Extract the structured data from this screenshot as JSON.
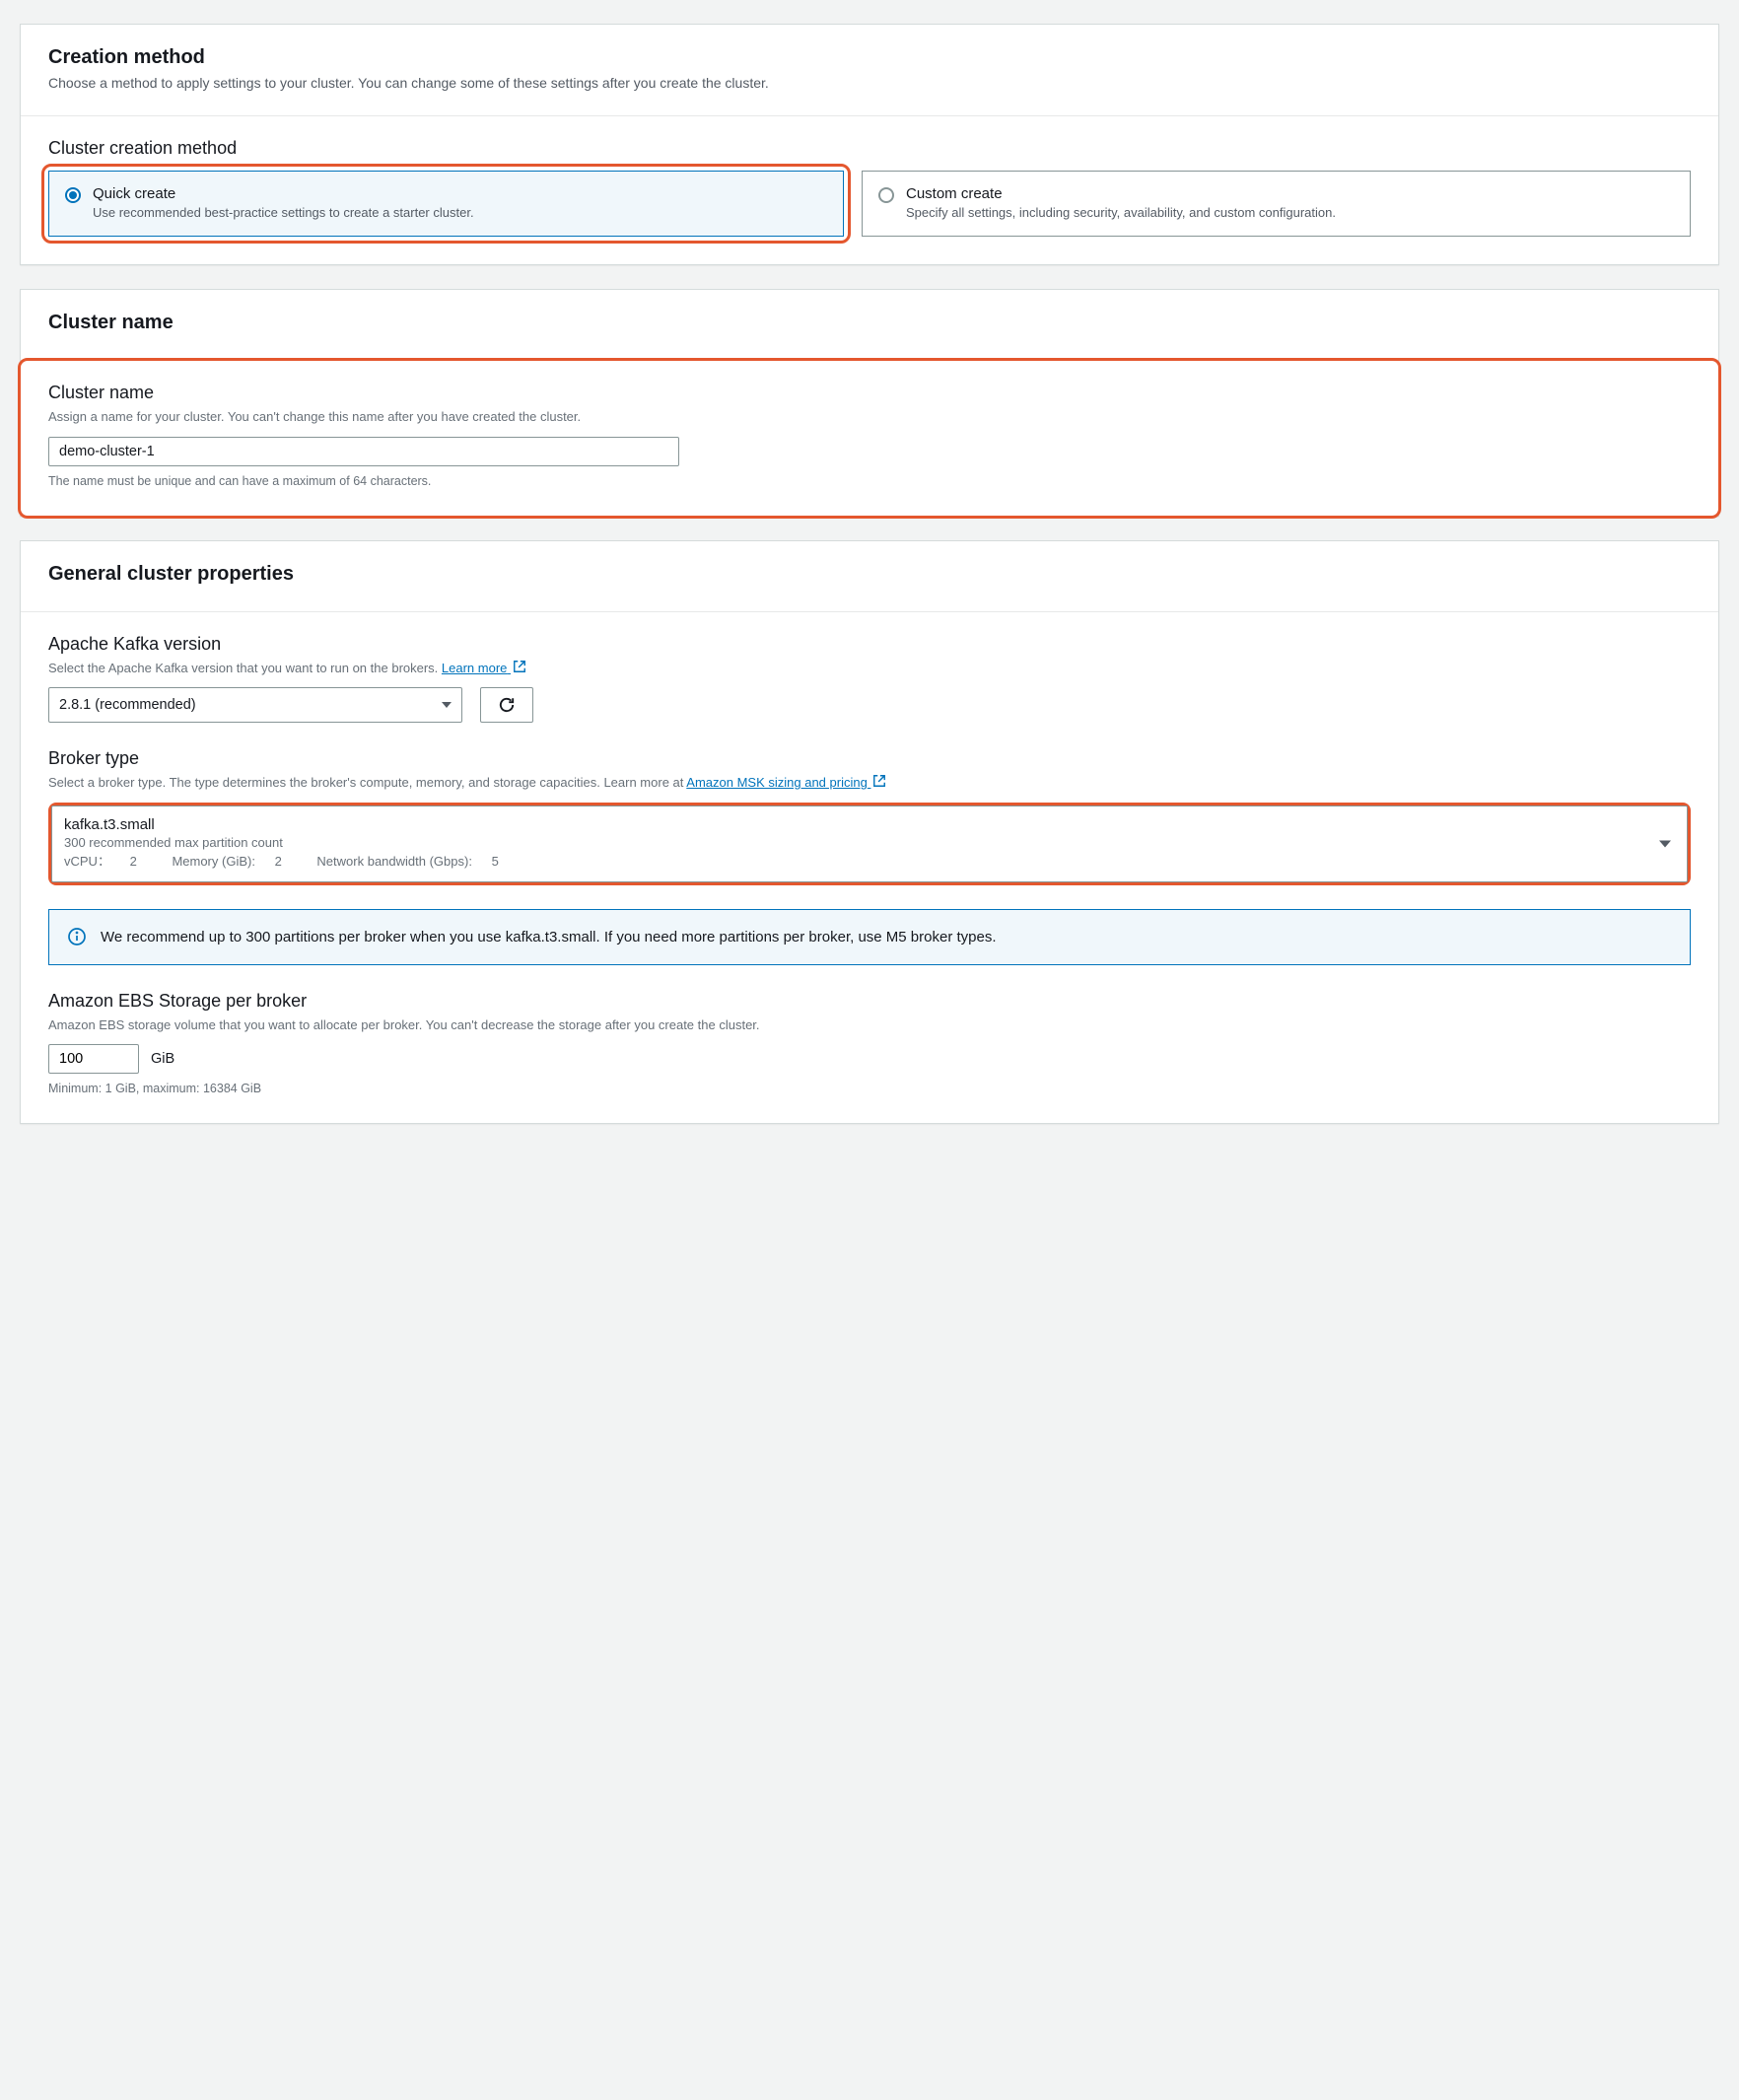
{
  "creation_method": {
    "title": "Creation method",
    "subtitle": "Choose a method to apply settings to your cluster. You can change some of these settings after you create the cluster.",
    "section_label": "Cluster creation method",
    "options": {
      "quick": {
        "title": "Quick create",
        "desc": "Use recommended best-practice settings to create a starter cluster."
      },
      "custom": {
        "title": "Custom create",
        "desc": "Specify all settings, including security, availability, and custom configuration."
      }
    }
  },
  "cluster_name": {
    "panel_title": "Cluster name",
    "field_label": "Cluster name",
    "field_desc": "Assign a name for your cluster. You can't change this name after you have created the cluster.",
    "value": "demo-cluster-1",
    "hint": "The name must be unique and can have a maximum of 64 characters."
  },
  "general": {
    "panel_title": "General cluster properties",
    "kafka_version": {
      "label": "Apache Kafka version",
      "desc_prefix": "Select the Apache Kafka version that you want to run on the brokers. ",
      "learn_more": "Learn more",
      "selected": "2.8.1 (recommended)"
    },
    "broker_type": {
      "label": "Broker type",
      "desc_prefix": "Select a broker type. The type determines the broker's compute, memory, and storage capacities. Learn more at ",
      "link_text": "Amazon MSK sizing and pricing",
      "selected": "kafka.t3.small",
      "partition_line": "300 recommended max partition count",
      "spec_vcpu_label": "vCPU：",
      "spec_vcpu": "2",
      "spec_mem_label": "Memory (GiB):",
      "spec_mem": "2",
      "spec_bw_label": "Network bandwidth (Gbps):",
      "spec_bw": "5",
      "info_text": "We recommend up to 300 partitions per broker when you use kafka.t3.small. If you need more partitions per broker, use M5 broker types."
    },
    "ebs": {
      "label": "Amazon EBS Storage per broker",
      "desc": "Amazon EBS storage volume that you want to allocate per broker. You can't decrease the storage after you create the cluster.",
      "value": "100",
      "unit": "GiB",
      "hint": "Minimum: 1 GiB, maximum: 16384 GiB"
    }
  }
}
